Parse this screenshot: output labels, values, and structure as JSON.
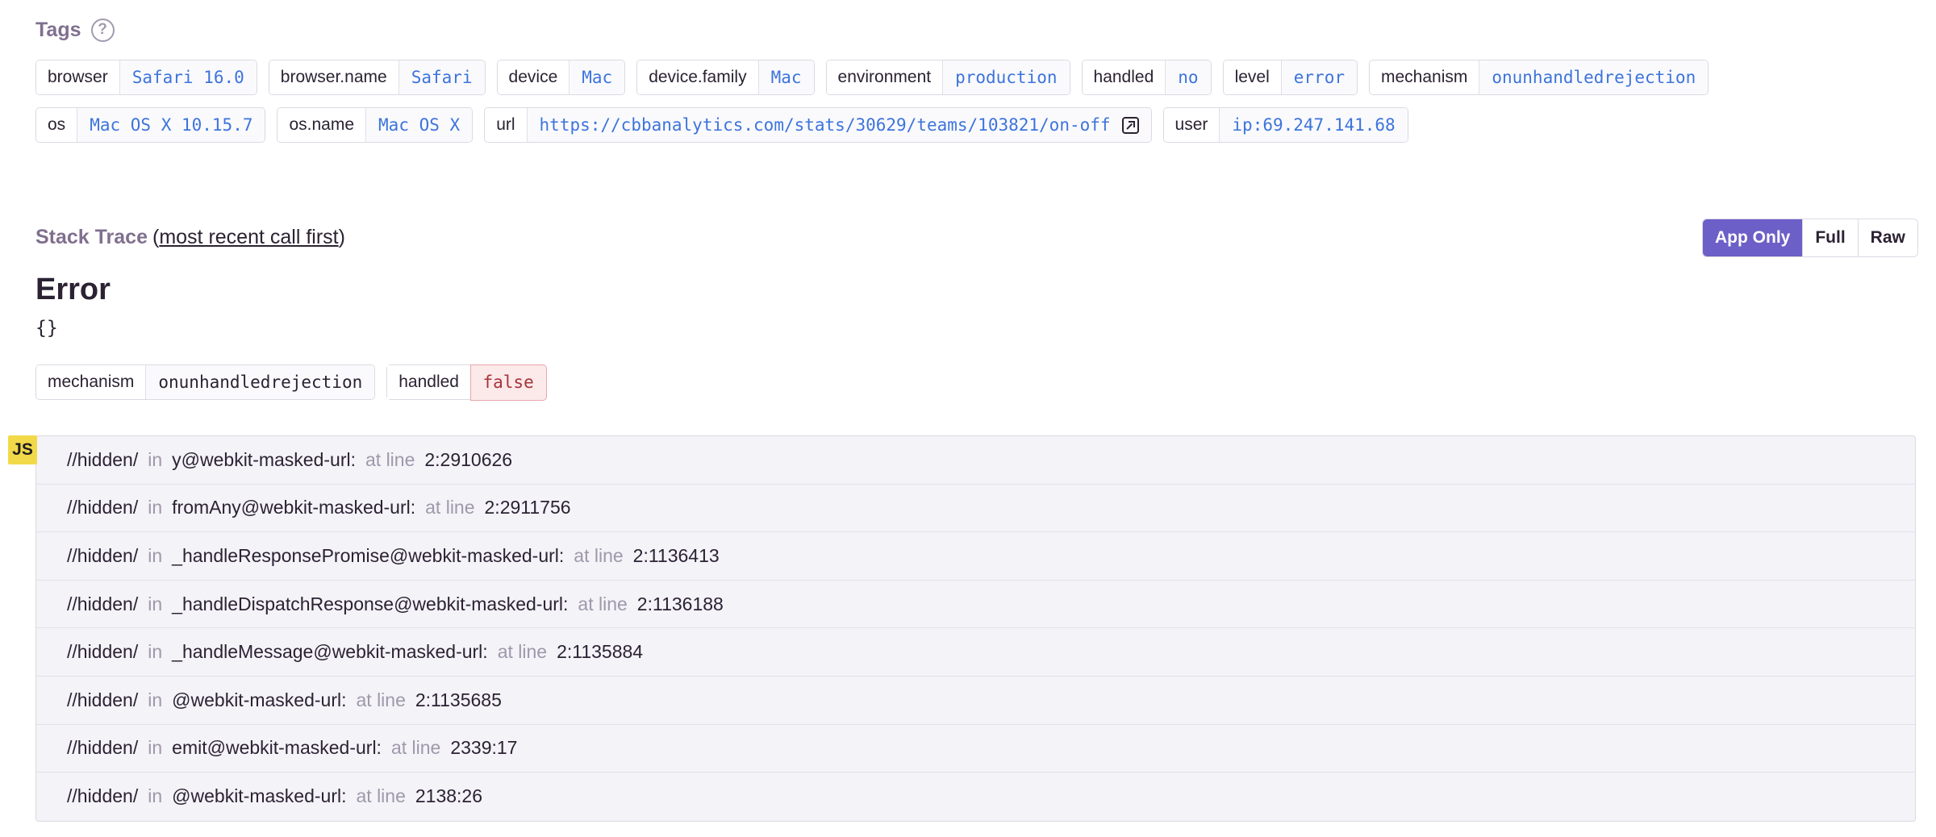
{
  "tags": {
    "title": "Tags",
    "help_glyph": "?",
    "rows": [
      [
        {
          "key": "browser",
          "value": "Safari 16.0"
        },
        {
          "key": "browser.name",
          "value": "Safari"
        },
        {
          "key": "device",
          "value": "Mac"
        },
        {
          "key": "device.family",
          "value": "Mac"
        },
        {
          "key": "environment",
          "value": "production"
        },
        {
          "key": "handled",
          "value": "no"
        },
        {
          "key": "level",
          "value": "error"
        },
        {
          "key": "mechanism",
          "value": "onunhandledrejection"
        }
      ],
      [
        {
          "key": "os",
          "value": "Mac OS X 10.15.7"
        },
        {
          "key": "os.name",
          "value": "Mac OS X"
        },
        {
          "key": "url",
          "value": "https://cbbanalytics.com/stats/30629/teams/103821/on-off",
          "external_link_icon": "external-link-icon"
        },
        {
          "key": "user",
          "value": "ip:69.247.141.68"
        }
      ]
    ]
  },
  "stack": {
    "title": "Stack Trace",
    "open_paren": "(",
    "order_link": "most recent call first",
    "close_paren": ")",
    "view_buttons": [
      {
        "label": "App Only",
        "active": true
      },
      {
        "label": "Full",
        "active": false
      },
      {
        "label": "Raw",
        "active": false
      }
    ],
    "error_type": "Error",
    "error_value": "{}",
    "mechanism_tags": [
      {
        "key": "mechanism",
        "value": "onunhandledrejection"
      },
      {
        "key": "handled",
        "value": "false"
      }
    ],
    "platform_badge": "JS",
    "frames": [
      {
        "path": "//hidden/",
        "in": "in",
        "function": "y@webkit-masked-url:",
        "at": "at line",
        "line": "2:2910626"
      },
      {
        "path": "//hidden/",
        "in": "in",
        "function": "fromAny@webkit-masked-url:",
        "at": "at line",
        "line": "2:2911756"
      },
      {
        "path": "//hidden/",
        "in": "in",
        "function": "_handleResponsePromise@webkit-masked-url:",
        "at": "at line",
        "line": "2:1136413"
      },
      {
        "path": "//hidden/",
        "in": "in",
        "function": "_handleDispatchResponse@webkit-masked-url:",
        "at": "at line",
        "line": "2:1136188"
      },
      {
        "path": "//hidden/",
        "in": "in",
        "function": "_handleMessage@webkit-masked-url:",
        "at": "at line",
        "line": "2:1135884"
      },
      {
        "path": "//hidden/",
        "in": "in",
        "function": "@webkit-masked-url:",
        "at": "at line",
        "line": "2:1135685"
      },
      {
        "path": "//hidden/",
        "in": "in",
        "function": "emit@webkit-masked-url:",
        "at": "at line",
        "line": "2339:17"
      },
      {
        "path": "//hidden/",
        "in": "in",
        "function": "@webkit-masked-url:",
        "at": "at line",
        "line": "2138:26"
      }
    ]
  },
  "colors": {
    "accent": "#6c5fc7",
    "tag_value": "#3d74db",
    "false_badge": "#a63438",
    "js_badge": "#f2d94a"
  }
}
